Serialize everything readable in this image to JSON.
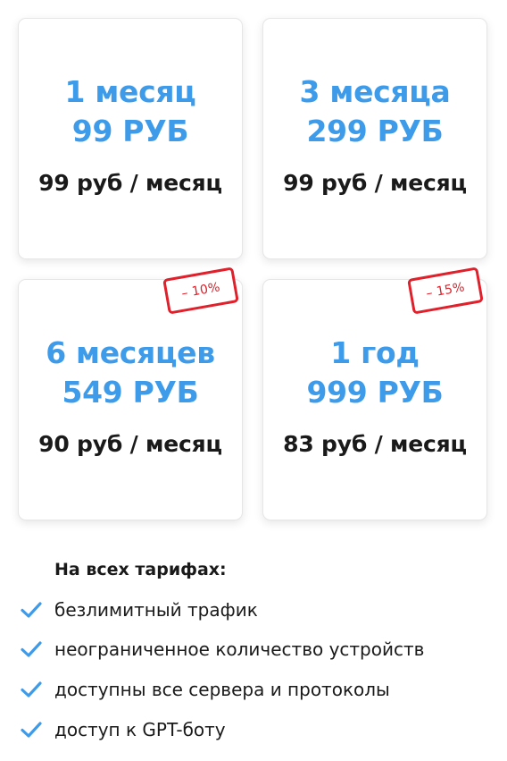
{
  "colors": {
    "accent": "#3d9be9",
    "badge_red": "#e0202a",
    "text": "#1a1a1a",
    "check": "#3d9be9"
  },
  "plans": [
    {
      "period": "1 месяц",
      "price": "99 РУБ",
      "monthly": "99 руб / месяц",
      "badge": ""
    },
    {
      "period": "3 месяца",
      "price": "299 РУБ",
      "monthly": "99 руб / месяц",
      "badge": ""
    },
    {
      "period": "6 месяцев",
      "price": "549 РУБ",
      "monthly": "90 руб / месяц",
      "badge": "– 10%"
    },
    {
      "period": "1 год",
      "price": "999 РУБ",
      "monthly": "83 руб / месяц",
      "badge": "– 15%"
    }
  ],
  "features": {
    "title": "На всех тарифах:",
    "check_icon": "checkmark-icon",
    "items": [
      "безлимитный трафик",
      "неограниченное количество устройств",
      "доступны все сервера и протоколы",
      "доступ к GPT-боту"
    ]
  }
}
